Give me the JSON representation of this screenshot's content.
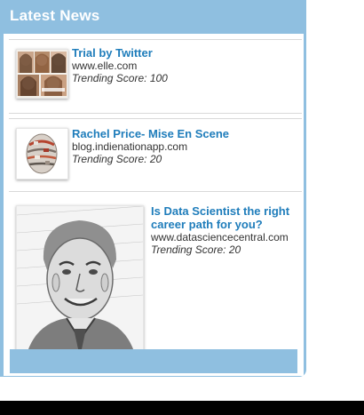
{
  "header": {
    "title": "Latest News"
  },
  "items": [
    {
      "title": "Trial by Twitter",
      "source": "www.elle.com",
      "score": "Trending Score: 100",
      "thumb_icon": "collage-thumbnail"
    },
    {
      "title": "Rachel Price- Mise En Scene",
      "source": "blog.indienationapp.com",
      "score": "Trending Score: 20",
      "thumb_icon": "sphere-thumbnail"
    },
    {
      "title": "Is Data Scientist the right career path for you?",
      "source": "www.datasciencecentral.com",
      "score": "Trending Score: 20",
      "thumb_icon": "portrait-sketch-thumbnail"
    }
  ],
  "colors": {
    "header_bg": "#8fbfe0",
    "title_link": "#1f7dbb",
    "text": "#333333"
  }
}
